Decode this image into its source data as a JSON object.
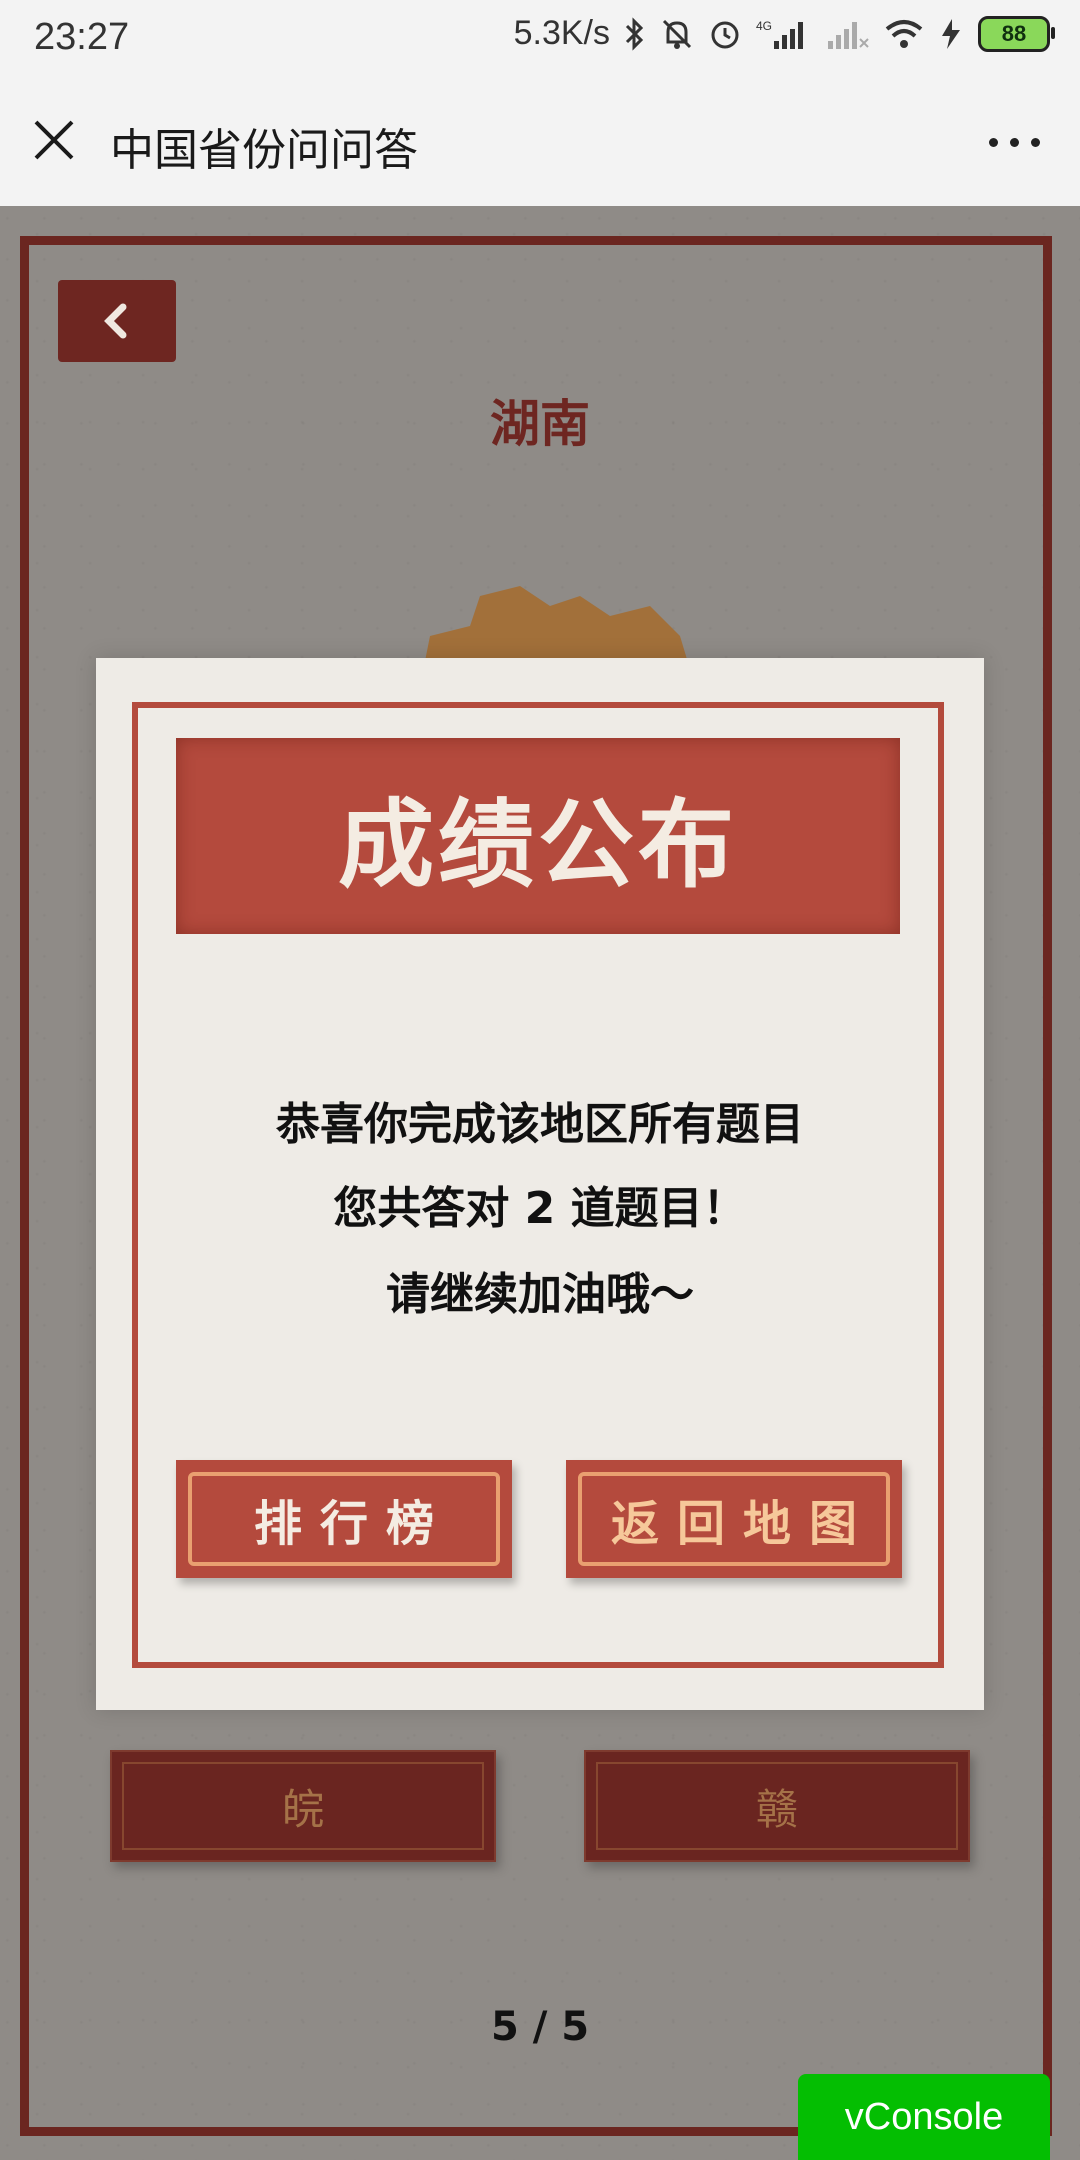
{
  "status": {
    "time": "23:27",
    "speed": "5.3K/s",
    "network": "4G",
    "battery": "88"
  },
  "titlebar": {
    "title": "中国省份问问答"
  },
  "game": {
    "province": "湖南",
    "options": [
      "皖",
      "赣"
    ],
    "page": "5 / 5"
  },
  "modal": {
    "title": "成绩公布",
    "line1": "恭喜你完成该地区所有题目",
    "line2": "您共答对 2 道题目！",
    "line3": "请继续加油哦～",
    "btn_rank": "排行榜",
    "btn_map": "返回地图"
  },
  "vconsole": {
    "label": "vConsole"
  },
  "colors": {
    "primary_red": "#b44a3d",
    "dark_red": "#6e2621",
    "vconsole_green": "#04be02"
  }
}
